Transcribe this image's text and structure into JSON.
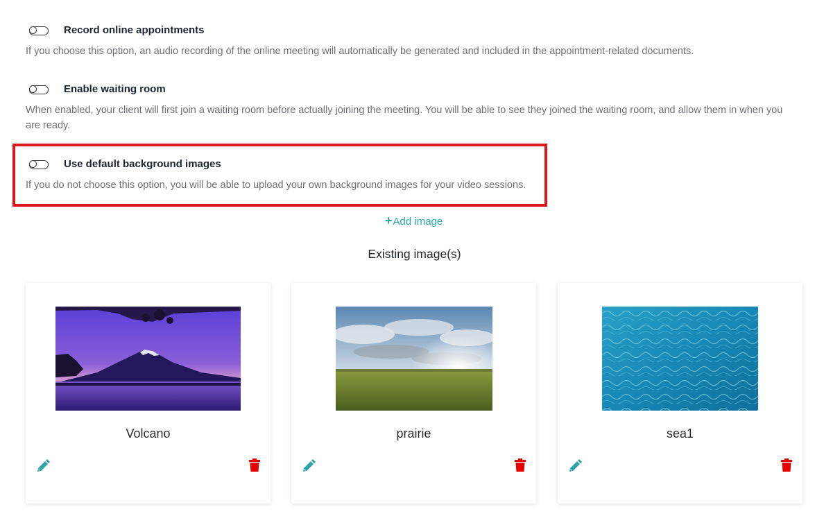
{
  "settings": [
    {
      "title": "Record online appointments",
      "description": "If you choose this option, an audio recording of the online meeting will automatically be generated and included in the appointment-related documents.",
      "enabled": false
    },
    {
      "title": "Enable waiting room",
      "description": "When enabled, your client will first join a waiting room before actually joining the meeting. You will be able to see they joined the waiting room, and allow them in when you are ready.",
      "enabled": false
    },
    {
      "title": "Use default background images",
      "description": "If you do not choose this option, you will be able to upload your own background images for your video sessions.",
      "enabled": false
    }
  ],
  "add_image": {
    "plus": "+",
    "label": "Add image"
  },
  "existing_title": "Existing image(s)",
  "images": [
    {
      "name": "Volcano",
      "edit_icon": "pencil-icon",
      "delete_icon": "trash-icon"
    },
    {
      "name": "prairie",
      "edit_icon": "pencil-icon",
      "delete_icon": "trash-icon"
    },
    {
      "name": "sea1",
      "edit_icon": "pencil-icon",
      "delete_icon": "trash-icon"
    }
  ],
  "colors": {
    "accent": "#2fa4a8",
    "delete": "#e60000",
    "highlight": "#e0161f"
  }
}
